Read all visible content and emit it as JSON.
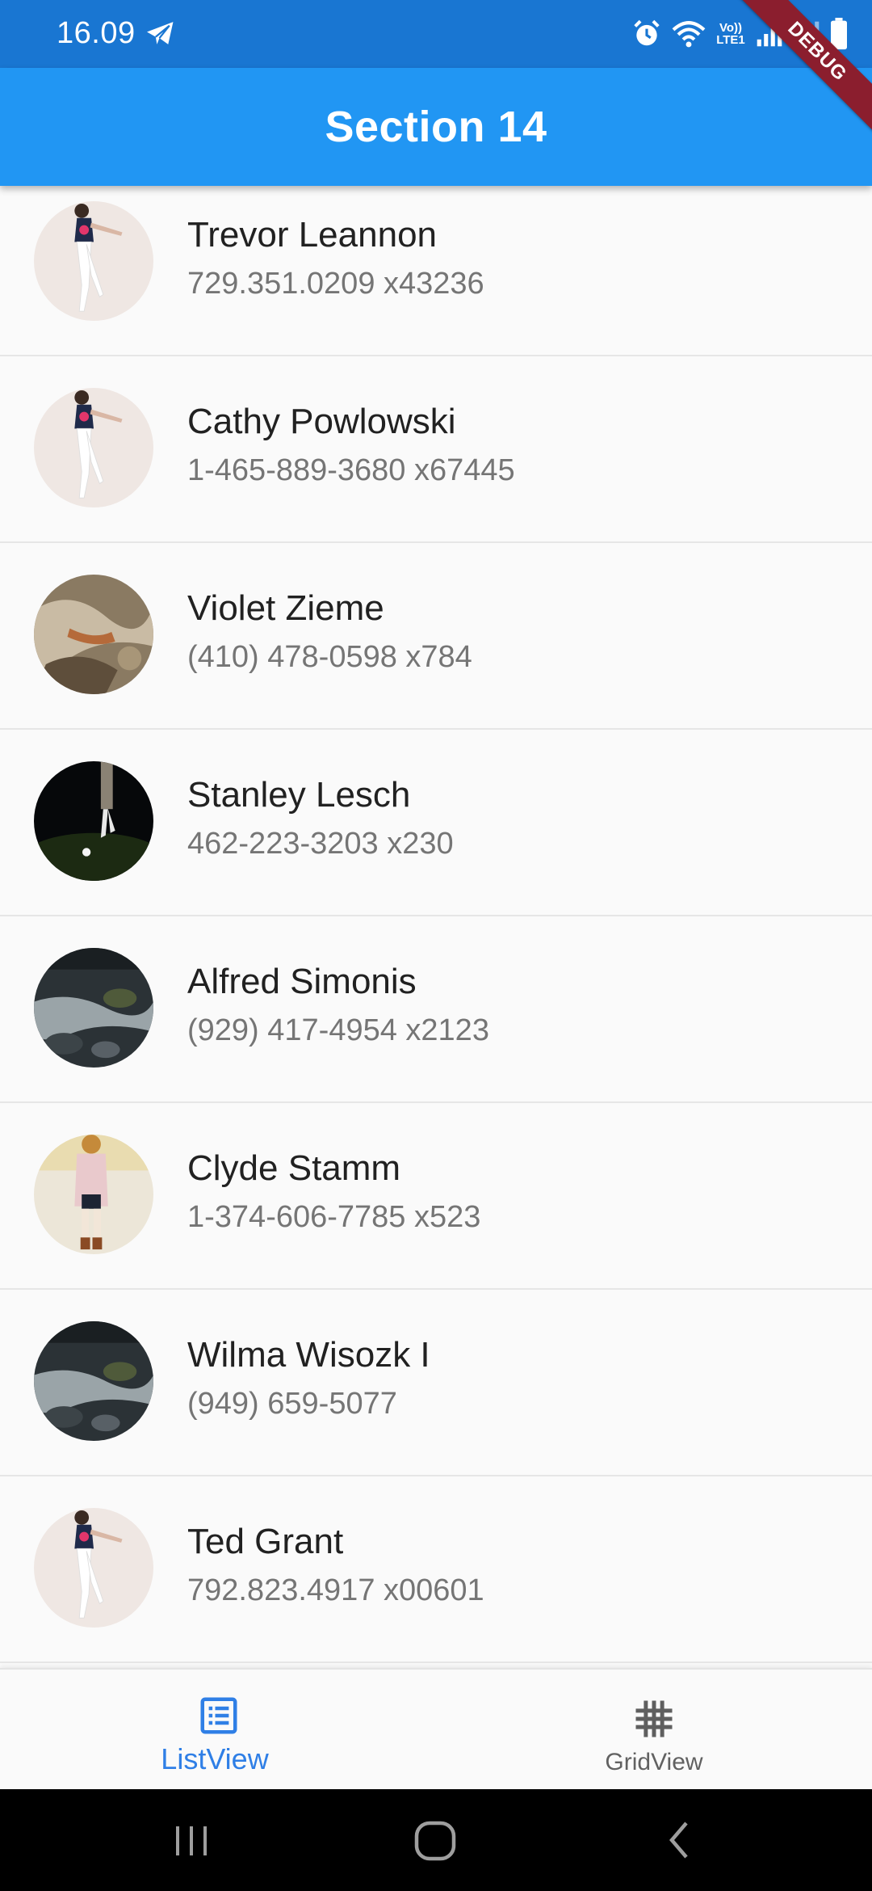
{
  "status_bar": {
    "time": "16.09",
    "network_label": "Vo)) LTE1",
    "icons": [
      "telegram-icon",
      "alarm-icon",
      "wifi-icon",
      "signal-icon",
      "signal-icon",
      "battery-icon"
    ]
  },
  "debug_banner": "DEBUG",
  "app_bar": {
    "title": "Section 14"
  },
  "contacts": [
    {
      "name": "Trevor Leannon",
      "phone": "729.351.0209 x43236",
      "avatar": "dancer"
    },
    {
      "name": "Cathy Powlowski",
      "phone": "1-465-889-3680 x67445",
      "avatar": "dancer"
    },
    {
      "name": "Violet Zieme",
      "phone": "(410) 478-0598 x784",
      "avatar": "rock"
    },
    {
      "name": "Stanley Lesch",
      "phone": "462-223-3203 x230",
      "avatar": "golf"
    },
    {
      "name": "Alfred Simonis",
      "phone": "(929) 417-4954 x2123",
      "avatar": "stream"
    },
    {
      "name": "Clyde Stamm",
      "phone": "1-374-606-7785 x523",
      "avatar": "fashion"
    },
    {
      "name": "Wilma Wisozk I",
      "phone": "(949) 659-5077",
      "avatar": "stream"
    },
    {
      "name": "Ted Grant",
      "phone": "792.823.4917 x00601",
      "avatar": "dancer"
    }
  ],
  "bottom_nav": {
    "items": [
      {
        "label": "ListView",
        "icon": "list-icon",
        "active": true
      },
      {
        "label": "GridView",
        "icon": "grid-icon",
        "active": false
      }
    ]
  },
  "colors": {
    "status_bar": "#1976d2",
    "app_bar": "#2196f3",
    "active_nav": "#2f7fe6",
    "debug_banner": "#8b1e2e"
  }
}
